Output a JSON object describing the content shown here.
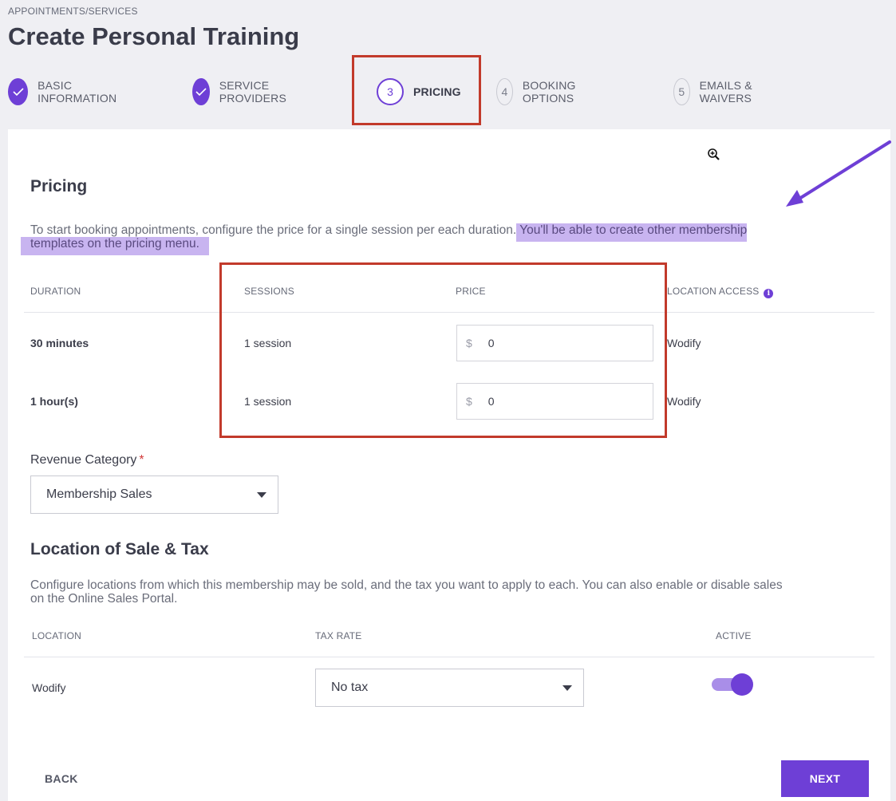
{
  "breadcrumb": "APPOINTMENTS/SERVICES",
  "page_title": "Create Personal Training",
  "steps": [
    {
      "number": "",
      "label": "BASIC INFORMATION",
      "state": "done"
    },
    {
      "number": "",
      "label": "SERVICE PROVIDERS",
      "state": "done"
    },
    {
      "number": "3",
      "label": "PRICING",
      "state": "current"
    },
    {
      "number": "4",
      "label": "BOOKING OPTIONS",
      "state": "todo"
    },
    {
      "number": "5",
      "label": "EMAILS & WAIVERS",
      "state": "todo"
    }
  ],
  "pricing": {
    "title": "Pricing",
    "desc_plain": "To start booking appointments, configure the price for a single session per each duration.",
    "desc_highlight_1": " You'll be able to create other membership",
    "desc_highlight_2": "templates on the pricing menu.",
    "columns": {
      "duration": "DURATION",
      "sessions": "SESSIONS",
      "price": "PRICE",
      "location_access": "LOCATION ACCESS"
    },
    "rows": [
      {
        "duration": "30 minutes",
        "sessions": "1 session",
        "currency": "$",
        "price": "0",
        "location": "Wodify"
      },
      {
        "duration": "1 hour(s)",
        "sessions": "1 session",
        "currency": "$",
        "price": "0",
        "location": "Wodify"
      }
    ]
  },
  "revenue": {
    "label": "Revenue Category",
    "required_mark": "*",
    "value": "Membership Sales"
  },
  "location_sale": {
    "title": "Location of Sale & Tax",
    "desc_line1": "Configure locations from which this membership may be sold, and the tax you want to apply to each. You can also enable or disable sales",
    "desc_line2": "on the Online Sales Portal.",
    "columns": {
      "location": "LOCATION",
      "tax_rate": "TAX RATE",
      "active": "ACTIVE"
    },
    "rows": [
      {
        "location": "Wodify",
        "tax_rate": "No tax",
        "active": true
      }
    ]
  },
  "footer": {
    "back": "BACK",
    "next": "NEXT"
  },
  "colors": {
    "accent": "#6e3fd6",
    "annotation": "#c23a2b",
    "highlight": "#c8b4f0"
  },
  "icons": {
    "check": "check-icon",
    "zoom": "zoom-in-icon",
    "info": "info-icon",
    "caret": "caret-down-icon"
  }
}
